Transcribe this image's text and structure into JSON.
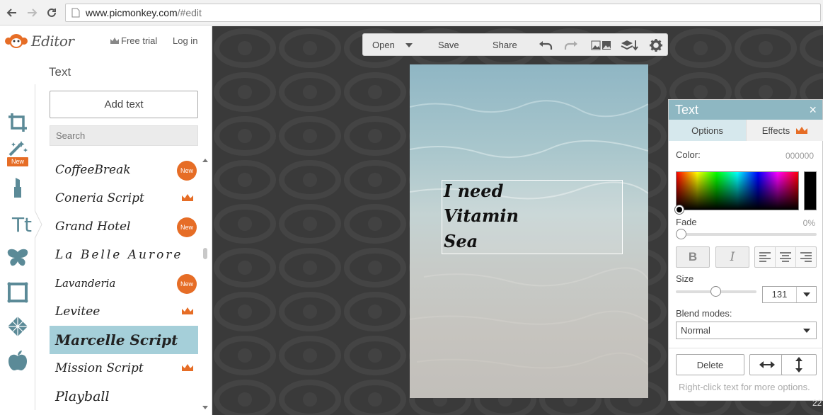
{
  "browser": {
    "url_host": "www.picmonkey.com",
    "url_path": "/#edit"
  },
  "app": {
    "brand": "Editor",
    "free_trial": "Free trial",
    "log_in": "Log in"
  },
  "tools": [
    {
      "name": "crop-icon"
    },
    {
      "name": "effects-wand-icon",
      "badge": "New"
    },
    {
      "name": "touch-up-lipstick-icon"
    },
    {
      "name": "text-tool-icon"
    },
    {
      "name": "overlays-butterfly-icon"
    },
    {
      "name": "frames-icon"
    },
    {
      "name": "textures-icon"
    },
    {
      "name": "themes-apple-icon"
    }
  ],
  "text_panel": {
    "title": "Text",
    "add_text": "Add text",
    "search_placeholder": "Search",
    "fonts": [
      {
        "name": "CoffeeBreak",
        "badge": "New"
      },
      {
        "name": "Coneria Script",
        "badge": "crown"
      },
      {
        "name": "Grand Hotel",
        "badge": "New"
      },
      {
        "name": "La Belle Aurore",
        "badge": ""
      },
      {
        "name": "Lavanderia",
        "badge": "New"
      },
      {
        "name": "Levitee",
        "badge": "crown"
      },
      {
        "name": "Marcelle Script",
        "badge": "",
        "selected": true
      },
      {
        "name": "Mission Script",
        "badge": "crown"
      },
      {
        "name": "Playball",
        "badge": ""
      }
    ]
  },
  "toolbar": {
    "open": "Open",
    "save": "Save",
    "share": "Share"
  },
  "canvas_text": {
    "line1": "I need",
    "line2": "Vitamin",
    "line3": "Sea"
  },
  "options_panel": {
    "title": "Text",
    "close": "×",
    "tab_options": "Options",
    "tab_effects": "Effects",
    "color_label": "Color:",
    "color_value": "000000",
    "fade_label": "Fade",
    "fade_value": "0%",
    "fade_level": 0,
    "bold": "B",
    "italic": "I",
    "size_label": "Size",
    "size_value": "131",
    "blend_label": "Blend modes:",
    "blend_value": "Normal",
    "delete": "Delete",
    "hint": "Right-click text for more options."
  },
  "corner_number": "22",
  "colors": {
    "accent_orange": "#e66d26",
    "panel_header": "#8eb7c2",
    "selected_row": "#a5cfd9",
    "workspace_bg": "#3a3a3a"
  }
}
